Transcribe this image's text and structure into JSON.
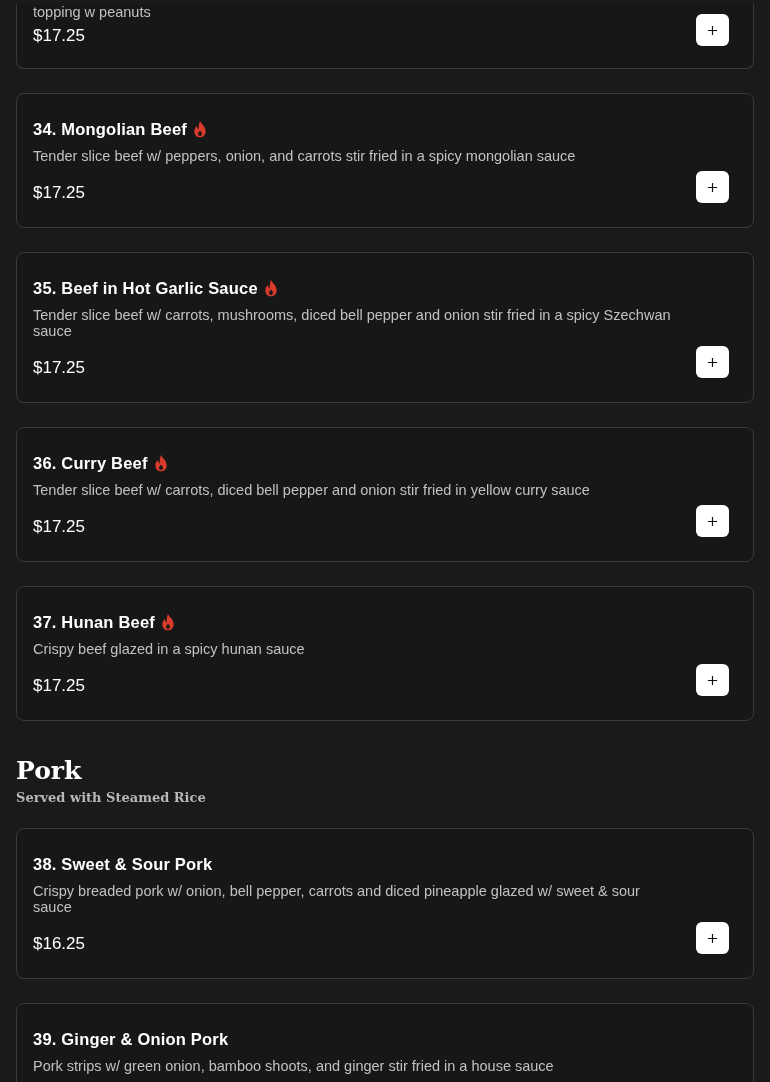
{
  "sections": [
    {
      "kind": "items",
      "items": [
        {
          "description": "topping w peanuts",
          "price": "$17.25",
          "spicy": false,
          "cut": true
        }
      ]
    },
    {
      "kind": "items",
      "items": [
        {
          "name": "34. Mongolian Beef",
          "description": "Tender slice beef w/ peppers, onion, and carrots stir fried in a spicy mongolian sauce",
          "price": "$17.25",
          "spicy": true
        },
        {
          "name": "35. Beef in Hot Garlic Sauce",
          "description": "Tender slice beef w/ carrots, mushrooms, diced bell pepper and onion stir fried in a spicy Szechwan sauce",
          "price": "$17.25",
          "spicy": true
        },
        {
          "name": "36. Curry Beef",
          "description": "Tender slice beef w/ carrots, diced bell pepper and onion stir fried in yellow curry sauce",
          "price": "$17.25",
          "spicy": true
        },
        {
          "name": "37. Hunan Beef",
          "description": "Crispy beef glazed in a spicy hunan sauce",
          "price": "$17.25",
          "spicy": true
        }
      ]
    },
    {
      "kind": "category",
      "title": "Pork",
      "subtitle": "Served with Steamed Rice",
      "items": [
        {
          "name": "38. Sweet & Sour Pork",
          "description": "Crispy breaded pork w/ onion, bell pepper, carrots and diced pineapple glazed w/ sweet & sour sauce",
          "price": "$16.25",
          "spicy": false
        },
        {
          "name": "39. Ginger & Onion Pork",
          "description": "Pork strips w/ green onion, bamboo shoots, and ginger stir fried in a house sauce",
          "spicy": false
        }
      ]
    }
  ]
}
